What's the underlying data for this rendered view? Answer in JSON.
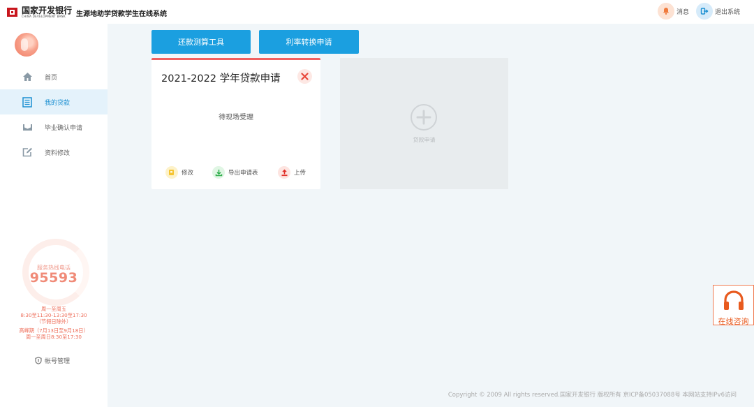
{
  "header": {
    "logo_cn": "国家开发银行",
    "logo_en": "CHINA DEVELOPMENT BANK",
    "system_title": "生源地助学贷款学生在线系统",
    "message_label": "消息",
    "logout_label": "退出系统"
  },
  "sidebar": {
    "items": [
      {
        "label": "首页",
        "icon": "home-icon"
      },
      {
        "label": "我的贷款",
        "icon": "document-list-icon"
      },
      {
        "label": "毕业确认申请",
        "icon": "inbox-icon"
      },
      {
        "label": "资料修改",
        "icon": "edit-icon"
      }
    ],
    "hotline": {
      "label": "服务热线电话",
      "number": "95593",
      "hours": [
        "周一至周五",
        "8:30至11:30-13:30至17:30",
        "（节假日除外）",
        "高峰期（7月13日至9月18日）",
        "周一至周日8:30至17:30"
      ]
    },
    "account_label": "帐号管理"
  },
  "toolbar": {
    "repay_tool": "还款测算工具",
    "rate_convert": "利率转换申请"
  },
  "loan_card": {
    "title": "2021-2022 学年贷款申请",
    "status": "待现场受理",
    "actions": {
      "edit": "修改",
      "export": "导出申请表",
      "upload": "上传"
    }
  },
  "add_card": {
    "label": "贷款申请"
  },
  "consult": {
    "label": "在线咨询"
  },
  "footer": {
    "text": "Copyright © 2009 All rights reserved.国家开发银行 版权所有 京ICP备05037088号 本网站支持IPv6访问"
  },
  "colors": {
    "primary": "#1b9fe0",
    "accent_red": "#f06060",
    "hotline": "#f08b78",
    "consult": "#e85a1e",
    "sidebar_active_bg": "#e4f2fb"
  }
}
